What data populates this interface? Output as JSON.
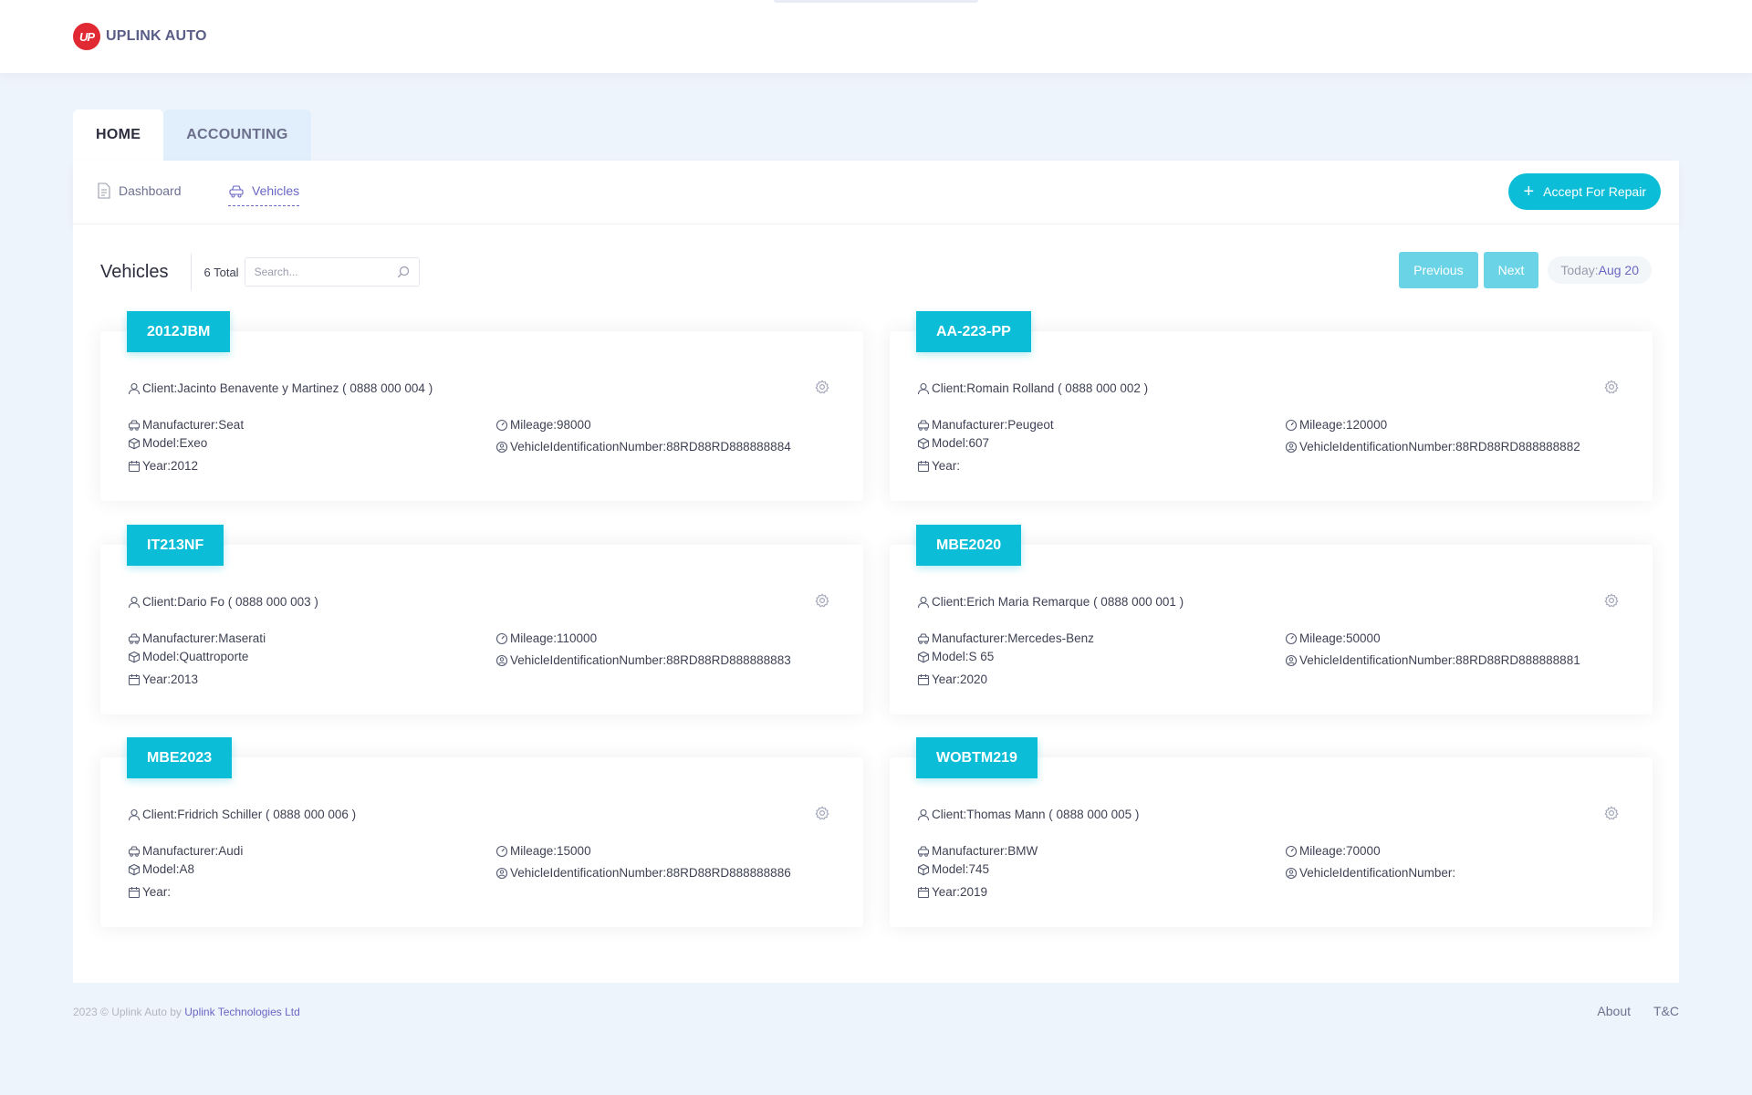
{
  "brand": {
    "logo": "UP",
    "name": "UPLINK AUTO"
  },
  "tabs": [
    {
      "label": "HOME"
    },
    {
      "label": "ACCOUNTING"
    }
  ],
  "subnav": {
    "items": [
      {
        "label": "Dashboard",
        "icon": "document-icon"
      },
      {
        "label": "Vehicles",
        "icon": "vehicles-icon"
      }
    ],
    "accept_button": "Accept For Repair",
    "accept_icon": "+"
  },
  "toolbar": {
    "title": "Vehicles",
    "total": "6 Total",
    "search_placeholder": "Search...",
    "previous": "Previous",
    "next": "Next",
    "today_label": "Today:",
    "today_value": "Aug 20"
  },
  "labels": {
    "client": "Client: ",
    "manufacturer": "Manufacturer: ",
    "model": "Model: ",
    "year": "Year: ",
    "mileage": "Mileage: ",
    "vin": "VehicleIdentificationNumber: "
  },
  "vehicles": [
    {
      "plate": "2012JBM",
      "client": "Jacinto Benavente y Martinez ( 0888 000 004 )",
      "manufacturer": "Seat",
      "model": "Exeo",
      "year": "2012",
      "mileage": "98000",
      "vin": "88RD88RD888888884"
    },
    {
      "plate": "AA-223-PP",
      "client": "Romain Rolland ( 0888 000 002 )",
      "manufacturer": "Peugeot",
      "model": "607",
      "year": "",
      "mileage": "120000",
      "vin": "88RD88RD888888882"
    },
    {
      "plate": "IT213NF",
      "client": "Dario Fo ( 0888 000 003 )",
      "manufacturer": "Maserati",
      "model": "Quattroporte",
      "year": "2013",
      "mileage": "110000",
      "vin": "88RD88RD888888883"
    },
    {
      "plate": "MBE2020",
      "client": "Erich Maria Remarque ( 0888 000 001 )",
      "manufacturer": "Mercedes-Benz",
      "model": "S 65",
      "year": "2020",
      "mileage": "50000",
      "vin": "88RD88RD888888881"
    },
    {
      "plate": "MBE2023",
      "client": "Fridrich Schiller ( 0888 000 006 )",
      "manufacturer": "Audi",
      "model": "A8",
      "year": "",
      "mileage": "15000",
      "vin": "88RD88RD888888886"
    },
    {
      "plate": "WOBTM219",
      "client": "Thomas Mann ( 0888 000 005 )",
      "manufacturer": "BMW",
      "model": "745",
      "year": "2019",
      "mileage": "70000",
      "vin": ""
    }
  ],
  "footer": {
    "copyright": "2023 © Uplink Auto by ",
    "company": "Uplink Technologies Ltd",
    "links": [
      "About",
      "T&C"
    ]
  },
  "colors": {
    "accent": "#0bbdd6",
    "accent_light": "#6bd3e6",
    "link": "#6a66c4",
    "brand_red": "#e02932",
    "background": "#eef4fb"
  }
}
